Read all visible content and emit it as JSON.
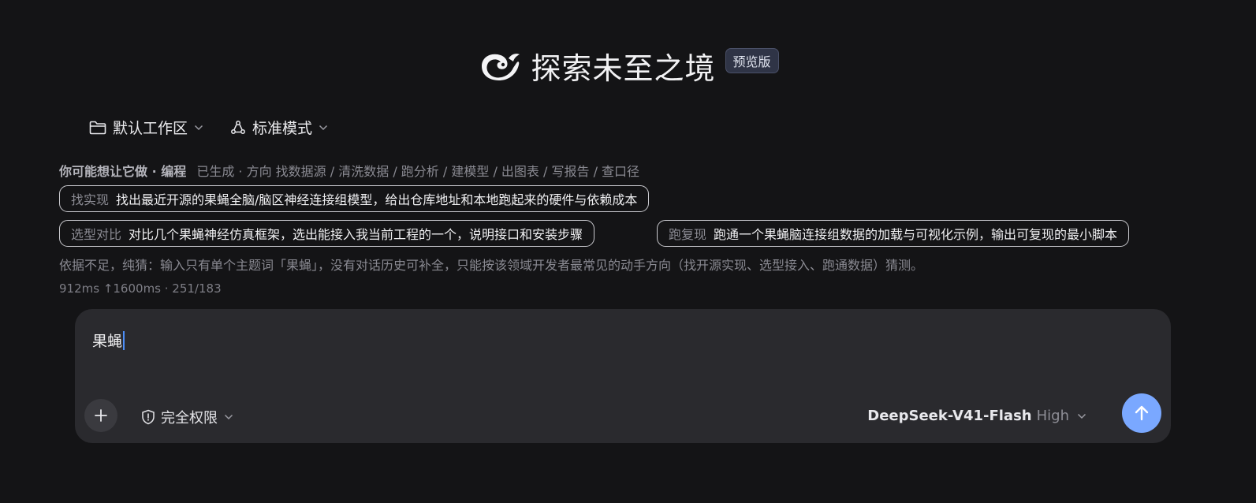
{
  "header": {
    "title": "探索未至之境",
    "badge": "预览版",
    "logo_icon": "whale-logo-icon"
  },
  "controls": {
    "workspace": {
      "label": "默认工作区",
      "icon": "folder-icon"
    },
    "mode": {
      "label": "标准模式",
      "icon": "mode-cycle-icon"
    }
  },
  "suggestions": {
    "prefix": "你可能想让它做 · 编程",
    "directions": "已生成 · 方向 找数据源 / 清洗数据 / 跑分析 / 建模型 / 出图表 / 写报告 / 查口径",
    "chips": [
      {
        "tag": "找实现",
        "text": "找出最近开源的果蝇全脑/脑区神经连接组模型，给出仓库地址和本地跑起来的硬件与依赖成本"
      },
      {
        "tag": "选型对比",
        "text": "对比几个果蝇神经仿真框架，选出能接入我当前工程的一个，说明接口和安装步骤"
      },
      {
        "tag": "跑复现",
        "text": "跑通一个果蝇脑连接组数据的加载与可视化示例，输出可复现的最小脚本"
      }
    ],
    "reason": "依据不足，纯猜：输入只有单个主题词「果蝇」，没有对话历史可补全，只能按该领域开发者最常见的动手方向（找开源实现、选型接入、跑通数据）猜测。",
    "stats": "912ms ↑1600ms · 251/183"
  },
  "composer": {
    "input_value": "果蝇",
    "permission_label": "完全权限",
    "model_name": "DeepSeek-V41-Flash",
    "model_level": "High"
  },
  "colors": {
    "background": "#141416",
    "composer_bg": "#2a2a2e",
    "send_button": "#7aa8ff",
    "badge_bg": "#2f3446",
    "caret": "#4d8ef7"
  }
}
